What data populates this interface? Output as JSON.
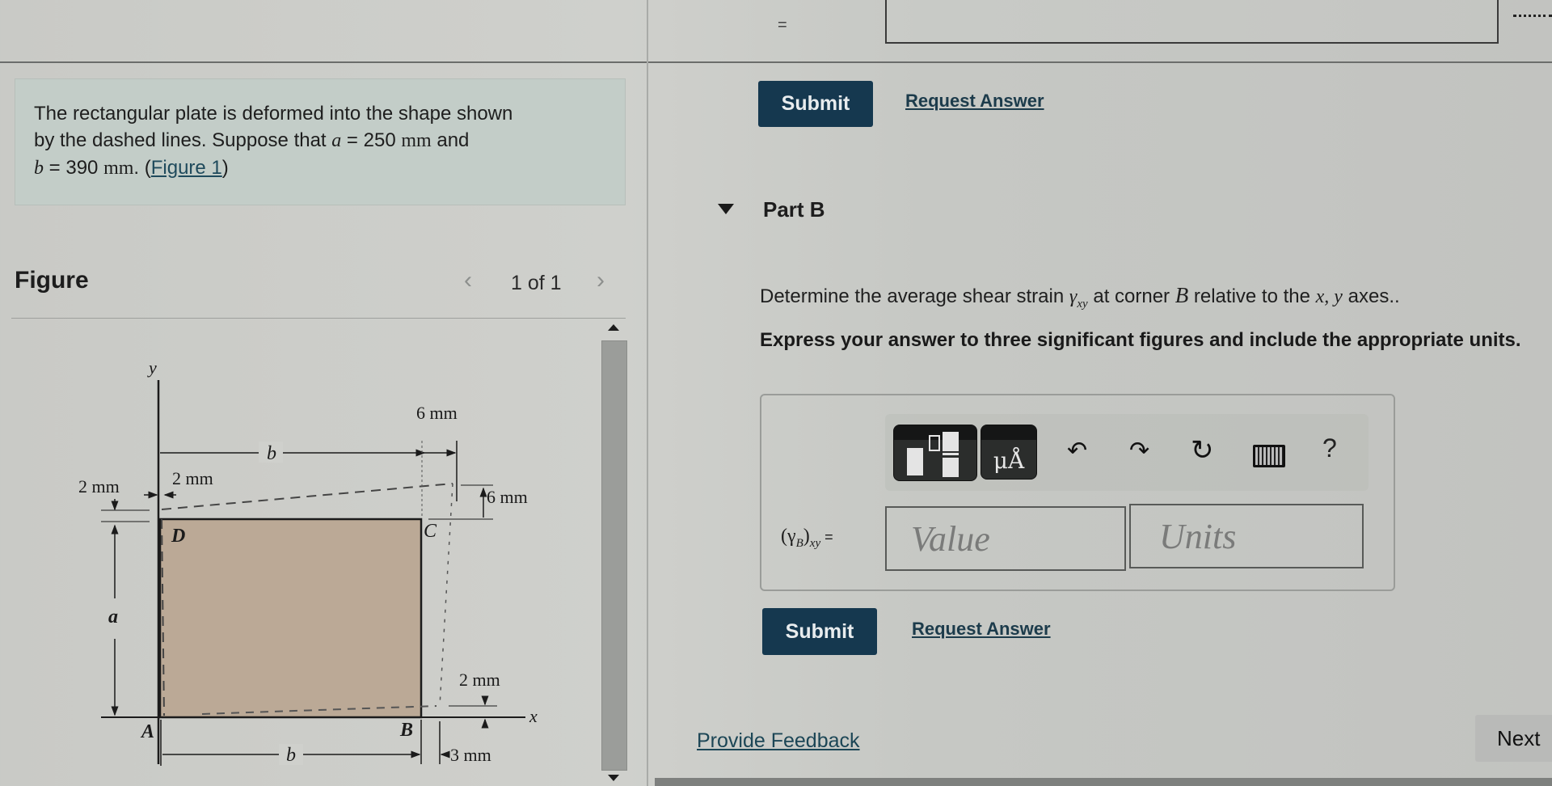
{
  "top_strip": {
    "equals_sign": "="
  },
  "intro": {
    "line1": "The rectangular plate is deformed into the shape shown",
    "line2_pre": "by the dashed lines. Suppose that ",
    "a_var": "a",
    "a_value": " = 250 ",
    "a_unit": "mm",
    "line2_post": " and",
    "b_var": "b",
    "b_value": " = 390 ",
    "b_unit": "mm",
    "period": ". (",
    "figure_link": "Figure 1",
    "close_paren": ")"
  },
  "part_a_actions": {
    "submit_label": "Submit",
    "request_answer_label": "Request Answer"
  },
  "part_b": {
    "title": "Part B",
    "toggle_icon": "caret-down-icon",
    "question_pre": "Determine the average shear strain ",
    "question_symbol": "γ",
    "question_symbol_sub": "xy",
    "question_mid": " at corner ",
    "question_corner": "B",
    "question_post": " relative to the ",
    "question_axes": "x, y",
    "question_end": " axes..",
    "instruction": "Express your answer to three significant figures and include the appropriate units.",
    "toolbar": {
      "template_icon": "fraction-template-icon",
      "units_label": "μÅ",
      "undo_icon": "undo-icon",
      "redo_icon": "redo-icon",
      "reset_icon": "reset-icon",
      "keyboard_icon": "keyboard-icon",
      "help_label": "?"
    },
    "answer_label_pre": "(γ",
    "answer_label_sub1": "B",
    "answer_label_mid": ")",
    "answer_label_sub2": "xy",
    "answer_label_eq": " =",
    "value_placeholder": "Value",
    "units_placeholder": "Units",
    "submit_label": "Submit",
    "request_answer_label": "Request Answer"
  },
  "figure_panel": {
    "title": "Figure",
    "prev_icon": "‹",
    "pager": "1 of 1",
    "next_icon": "›",
    "diagram": {
      "axis_x": "x",
      "axis_y": "y",
      "corner_A": "A",
      "corner_B": "B",
      "corner_C": "C",
      "corner_D": "D",
      "dim_a": "a",
      "dim_b_top": "b",
      "dim_b_bottom": "b",
      "dim_top_right": "6 mm",
      "dim_right_vertical": "6 mm",
      "dim_left_2mm_vertical": "2 mm",
      "dim_left_2mm_horizontal": "2 mm",
      "dim_bottom_right_2mm": "2 mm",
      "dim_bottom_right_3mm": "3 mm",
      "plate_color": "#bba996"
    }
  },
  "footer": {
    "feedback_label": "Provide Feedback",
    "next_label": "Next"
  },
  "colors": {
    "submit_bg": "#15384f",
    "link": "#1c3b4b",
    "intro_bg": "#c3cdc8"
  }
}
